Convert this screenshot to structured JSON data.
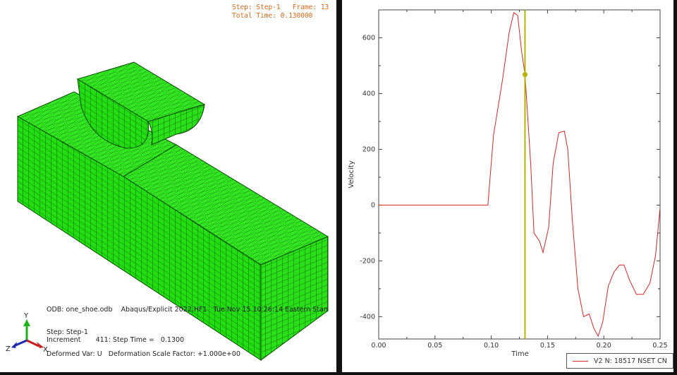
{
  "viewport": {
    "step_label": "Step: Step-1   Frame: 13",
    "total_time_label": "Total Time: 0.130000",
    "odb_line": "ODB: one_shoe.odb    Abaqus/Explicit 2022.HF1   Tue Nov 15 10:26:14 Eastern Stan",
    "step_line": "Step: Step-1",
    "increment_line": "Increment       411: Step Time =   0.1300",
    "deformed_line": "Deformed Var: U   Deformation Scale Factor: +1.000e+00",
    "triad": {
      "x": "X",
      "y": "Y",
      "z": "Z"
    },
    "mesh_color": "#22dd11"
  },
  "chart_data": {
    "type": "line",
    "xlabel": "Time",
    "ylabel": "Velocity",
    "xlim": [
      0,
      0.25
    ],
    "ylim": [
      -480,
      700
    ],
    "xticks": [
      "0.00",
      "0.05",
      "0.10",
      "0.15",
      "0.20",
      "0.25"
    ],
    "yticks": [
      "-400",
      "-200",
      "0",
      "200",
      "400",
      "600"
    ],
    "grid": false,
    "legend_position": "bottom-right",
    "series": [
      {
        "name": "V2 N: 18517 NSET CN",
        "color": "#d62728",
        "x": [
          0,
          0.097,
          0.102,
          0.11,
          0.116,
          0.12,
          0.1235,
          0.127,
          0.13,
          0.135,
          0.138,
          0.143,
          0.146,
          0.151,
          0.155,
          0.16,
          0.165,
          0.168,
          0.172,
          0.177,
          0.182,
          0.187,
          0.191,
          0.195,
          0.199,
          0.204,
          0.209,
          0.214,
          0.218,
          0.223,
          0.229,
          0.235,
          0.241,
          0.246,
          0.25
        ],
        "y": [
          0,
          0,
          250,
          450,
          620,
          690,
          680,
          550,
          468,
          150,
          -100,
          -130,
          -170,
          -80,
          150,
          260,
          265,
          200,
          -50,
          -300,
          -400,
          -390,
          -440,
          -470,
          -420,
          -290,
          -240,
          -215,
          -215,
          -270,
          -320,
          -320,
          -280,
          -180,
          -10
        ]
      }
    ],
    "cursor": {
      "x": 0.13,
      "y": 468,
      "color": "#b5b500"
    }
  }
}
